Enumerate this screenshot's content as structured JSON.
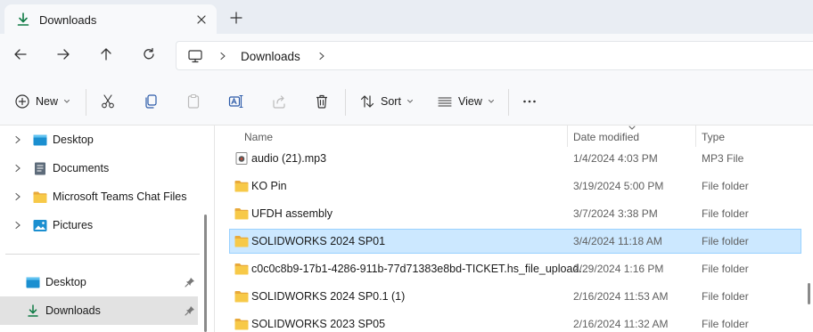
{
  "tab": {
    "title": "Downloads",
    "icon": "download-icon"
  },
  "address": {
    "crumbs": [
      "Downloads"
    ]
  },
  "commands": {
    "new_label": "New",
    "sort_label": "Sort",
    "view_label": "View"
  },
  "nav": {
    "tree": [
      {
        "label": "Desktop",
        "icon": "desktop-folder-icon"
      },
      {
        "label": "Documents",
        "icon": "documents-folder-icon"
      },
      {
        "label": "Microsoft Teams Chat Files",
        "icon": "folder-icon"
      },
      {
        "label": "Pictures",
        "icon": "pictures-folder-icon"
      }
    ],
    "quick": [
      {
        "label": "Desktop",
        "icon": "desktop-folder-icon",
        "pinned": true
      },
      {
        "label": "Downloads",
        "icon": "download-icon",
        "pinned": true,
        "selected": true
      }
    ]
  },
  "columns": {
    "name": "Name",
    "date": "Date modified",
    "type": "Type"
  },
  "files": [
    {
      "name": "audio (21).mp3",
      "date": "1/4/2024 4:03 PM",
      "type": "MP3 File",
      "icon": "audio-file-icon"
    },
    {
      "name": "KO Pin",
      "date": "3/19/2024 5:00 PM",
      "type": "File folder",
      "icon": "folder-icon"
    },
    {
      "name": "UFDH assembly",
      "date": "3/7/2024 3:38 PM",
      "type": "File folder",
      "icon": "folder-icon"
    },
    {
      "name": "SOLIDWORKS 2024 SP01",
      "date": "3/4/2024 11:18 AM",
      "type": "File folder",
      "icon": "folder-icon",
      "selected": true
    },
    {
      "name": "c0c0c8b9-17b1-4286-911b-77d71383e8bd-TICKET.hs_file_upload...",
      "date": "2/29/2024 1:16 PM",
      "type": "File folder",
      "icon": "folder-icon"
    },
    {
      "name": "SOLIDWORKS 2024 SP0.1 (1)",
      "date": "2/16/2024 11:53 AM",
      "type": "File folder",
      "icon": "folder-icon"
    },
    {
      "name": "SOLIDWORKS 2023 SP05",
      "date": "2/16/2024 11:32 AM",
      "type": "File folder",
      "icon": "folder-icon"
    }
  ],
  "colors": {
    "selection": "#cce8ff",
    "selection_border": "#99d1ff",
    "accent": "#0f7b45",
    "folder": "#f5c342"
  }
}
